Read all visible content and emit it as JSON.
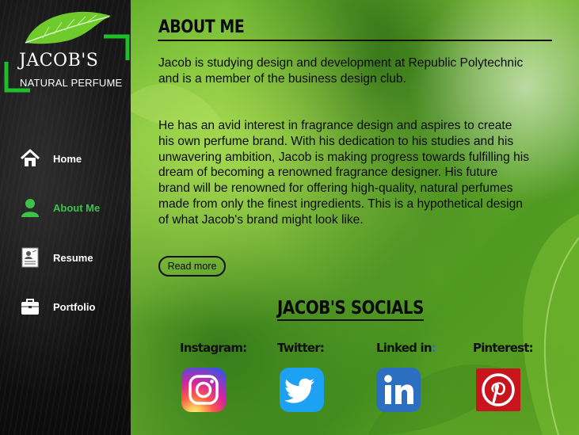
{
  "logo": {
    "brand": "JACOB'S",
    "tagline": "NATURAL PERFUME"
  },
  "nav": {
    "items": [
      {
        "label": "Home",
        "icon": "home-icon",
        "active": false
      },
      {
        "label": "About Me",
        "icon": "user-icon",
        "active": true
      },
      {
        "label": "Resume",
        "icon": "resume-icon",
        "active": false
      },
      {
        "label": "Portfolio",
        "icon": "briefcase-icon",
        "active": false
      }
    ]
  },
  "about": {
    "title": "ABOUT ME",
    "paragraph1": "Jacob is studying design and development at Republic Polytechnic and is a member of the business design club.",
    "paragraph2": "He has an avid interest in fragrance design and aspires to create his own perfume brand. With his dedication to his studies and his unwavering ambition, Jacob is making progress towards fulfilling his dream of becoming a renowned fragrance designer. His future brand will be renowned for offering high-quality, natural perfumes made from only the finest ingredients. This is a hypothetical design of what Jacob's brand might look like.",
    "read_more": "Read more"
  },
  "socials": {
    "title": "JACOB'S SOCIALS",
    "items": [
      {
        "label": "Instagram",
        "colon": ":",
        "icon": "instagram-icon"
      },
      {
        "label": "Twitter",
        "colon": ":",
        "icon": "twitter-icon"
      },
      {
        "label": "Linked in",
        "colon": ":",
        "icon": "linkedin-icon"
      },
      {
        "label": "Pinterest",
        "colon": ":",
        "icon": "pinterest-icon"
      }
    ]
  },
  "colors": {
    "accent_green": "#3ec24a",
    "sidebar_bg": "#151515",
    "instagram": "#d6249f",
    "twitter": "#1da1f2",
    "linkedin": "#2c6ebf",
    "pinterest": "#c8151d"
  }
}
